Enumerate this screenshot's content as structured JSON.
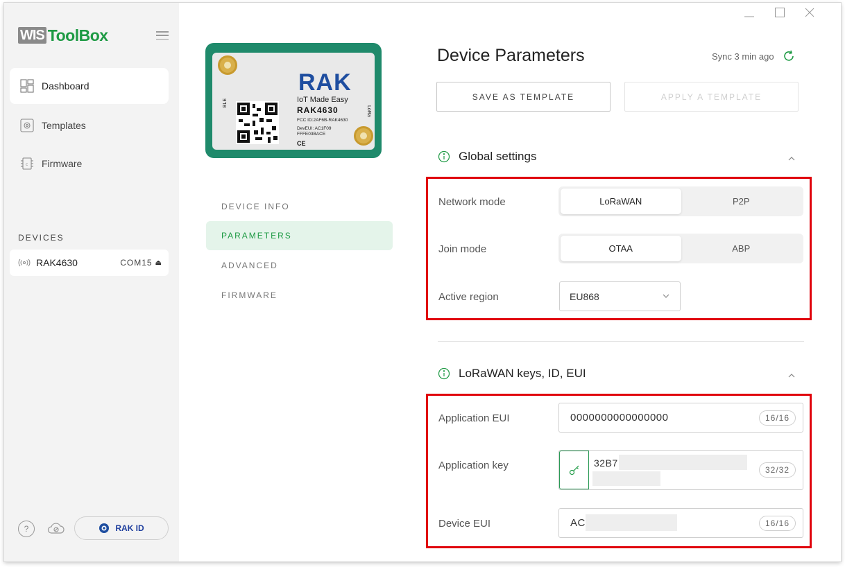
{
  "app": {
    "logo_wis": "WIS",
    "logo_toolbox": "ToolBox"
  },
  "window_controls": [
    "minimize",
    "maximize",
    "close"
  ],
  "sidebar": {
    "items": [
      {
        "label": "Dashboard",
        "icon": "dashboard-icon",
        "active": true
      },
      {
        "label": "Templates",
        "icon": "templates-icon",
        "active": false
      },
      {
        "label": "Firmware",
        "icon": "chip-icon",
        "active": false
      }
    ],
    "devices_title": "DEVICES",
    "device": {
      "name": "RAK4630",
      "port": "COM15"
    },
    "rak_id_label": "RAK ID"
  },
  "device_card": {
    "brand": "RAK",
    "tagline": "IoT Made Easy",
    "model": "RAK4630",
    "fcc": "FCC ID:2AF6B-RAK4630",
    "deveui_label": "DevEUI: AC1F09",
    "deveui_rest": "FFFE03BACE",
    "ble": "BLE",
    "lora": "LoRa",
    "ce": "CE"
  },
  "device_tabs": [
    {
      "label": "DEVICE INFO",
      "active": false
    },
    {
      "label": "PARAMETERS",
      "active": true
    },
    {
      "label": "ADVANCED",
      "active": false
    },
    {
      "label": "FIRMWARE",
      "active": false
    }
  ],
  "main": {
    "title": "Device Parameters",
    "sync_text": "Sync 3 min ago",
    "save_template": "SAVE AS TEMPLATE",
    "apply_template": "APPLY A TEMPLATE",
    "global_settings": {
      "title": "Global settings",
      "network_mode": {
        "label": "Network mode",
        "options": [
          "LoRaWAN",
          "P2P"
        ],
        "selected": "LoRaWAN"
      },
      "join_mode": {
        "label": "Join mode",
        "options": [
          "OTAA",
          "ABP"
        ],
        "selected": "OTAA"
      },
      "active_region": {
        "label": "Active region",
        "value": "EU868"
      }
    },
    "keys": {
      "title": "LoRaWAN keys, ID, EUI",
      "app_eui": {
        "label": "Application EUI",
        "value": "0000000000000000",
        "counter": "16/16"
      },
      "app_key": {
        "label": "Application key",
        "value": "32B7",
        "counter": "32/32"
      },
      "dev_eui": {
        "label": "Device EUI",
        "value": "AC",
        "counter": "16/16"
      }
    }
  },
  "colors": {
    "accent": "#1e9a44",
    "highlight": "#e0000b",
    "rak_blue": "#1f4ea0",
    "card_green": "#1f8a6b"
  }
}
